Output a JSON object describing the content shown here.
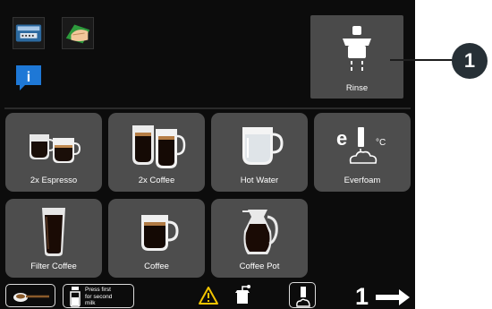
{
  "status_icons": [
    {
      "icon": "card-reader-icon"
    },
    {
      "icon": "cleaning-hand-icon"
    },
    {
      "icon": "info-icon",
      "glyph": "i"
    }
  ],
  "rinse": {
    "label": "Rinse",
    "icon": "rinse-icon"
  },
  "callout": {
    "number": "1"
  },
  "tiles": [
    {
      "label": "2x Espresso",
      "icon": "double-espresso-cups-icon"
    },
    {
      "label": "2x Coffee",
      "icon": "double-coffee-glasses-icon"
    },
    {
      "label": "Hot Water",
      "icon": "hot-water-glass-icon"
    },
    {
      "label": "Everfoam",
      "icon": "everfoam-icon",
      "unit": "°C"
    },
    {
      "label": "Filter Coffee",
      "icon": "filter-coffee-glass-icon"
    },
    {
      "label": "Coffee",
      "icon": "coffee-cup-icon"
    },
    {
      "label": "Coffee Pot",
      "icon": "coffee-pot-icon"
    }
  ],
  "bottom_bar": {
    "scoop_icon": "powder-scoop-icon",
    "milk_hint": {
      "line1": "Press first",
      "line2": "for second",
      "line3": "milk"
    },
    "warning_icon": "warning-icon",
    "grinder_icon": "grinder-icon",
    "dispense_icon": "dispense-icon",
    "page_number": "1",
    "next_icon": "arrow-right-icon"
  },
  "colors": {
    "background": "#0c0c0c",
    "tile": "#4d4d4d",
    "info_blue": "#1e78d6",
    "warning_yellow": "#f2c400",
    "callout": "#273036"
  }
}
